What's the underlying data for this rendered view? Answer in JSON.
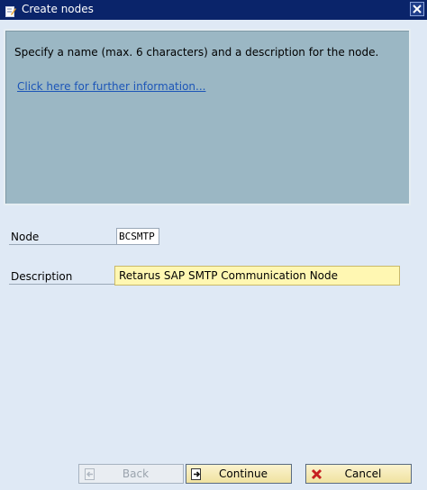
{
  "window": {
    "title": "Create nodes",
    "icon": "edit-icon",
    "close_icon": "close-icon"
  },
  "info": {
    "text": "Specify a name (max. 6 characters) and a description for the node.",
    "link": "Click here for further information..."
  },
  "form": {
    "node_label": "Node",
    "node_value": "BCSMTP",
    "description_label": "Description",
    "description_value": "Retarus SAP SMTP Communication Node"
  },
  "buttons": {
    "back": {
      "label": "Back",
      "icon": "back-icon",
      "enabled": false
    },
    "continue": {
      "label": "Continue",
      "icon": "continue-icon",
      "enabled": true
    },
    "cancel": {
      "label": "Cancel",
      "icon": "cancel-icon",
      "enabled": true
    }
  },
  "colors": {
    "titlebar": "#0a246a",
    "info_panel": "#9bb7c4",
    "background": "#dfe9f5",
    "required_field": "#fff7b2",
    "link": "#1d56b8"
  }
}
